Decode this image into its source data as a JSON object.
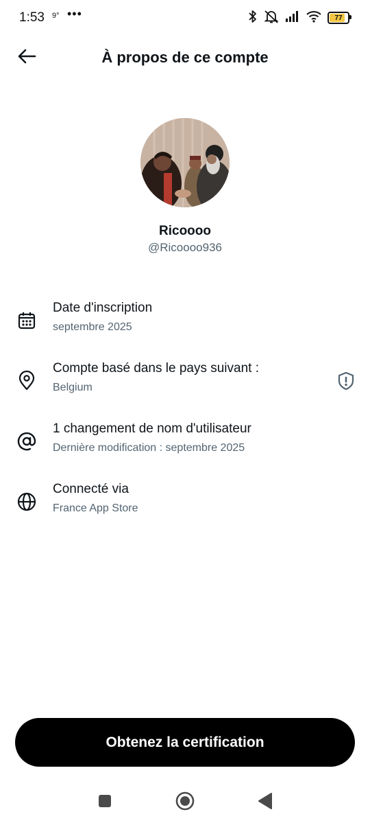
{
  "status_bar": {
    "time": "1:53",
    "small_indicator": "9°",
    "dots": "•••",
    "battery_level": "77",
    "battery_fraction": 0.77,
    "battery_color": "#f3c642",
    "icons": [
      "bluetooth-icon",
      "muted-bell-icon",
      "signal-icon",
      "wifi-icon",
      "battery-icon"
    ]
  },
  "header": {
    "back_icon": "arrow-left-icon",
    "title": "À propos de ce compte"
  },
  "profile": {
    "display_name": "Ricoooo",
    "handle": "@Ricoooo936"
  },
  "details": [
    {
      "icon": "calendar-icon",
      "title": "Date d'inscription",
      "subtitle": "septembre 2025"
    },
    {
      "icon": "location-pin-icon",
      "title": "Compte basé dans le pays suivant :",
      "subtitle": "Belgium",
      "trailing_icon": "shield-alert-icon"
    },
    {
      "icon": "at-sign-icon",
      "title": "1 changement de nom d'utilisateur",
      "subtitle": "Dernière modification : septembre 2025"
    },
    {
      "icon": "globe-icon",
      "title": "Connecté via",
      "subtitle": "France App Store"
    }
  ],
  "cta": {
    "label": "Obtenez la certification"
  },
  "nav_bar": {
    "icons": [
      "square-icon",
      "home-circle-icon",
      "back-triangle-icon"
    ]
  },
  "colors": {
    "text": "#0f1419",
    "secondary": "#536471",
    "button_bg": "#000000",
    "button_text": "#ffffff"
  }
}
